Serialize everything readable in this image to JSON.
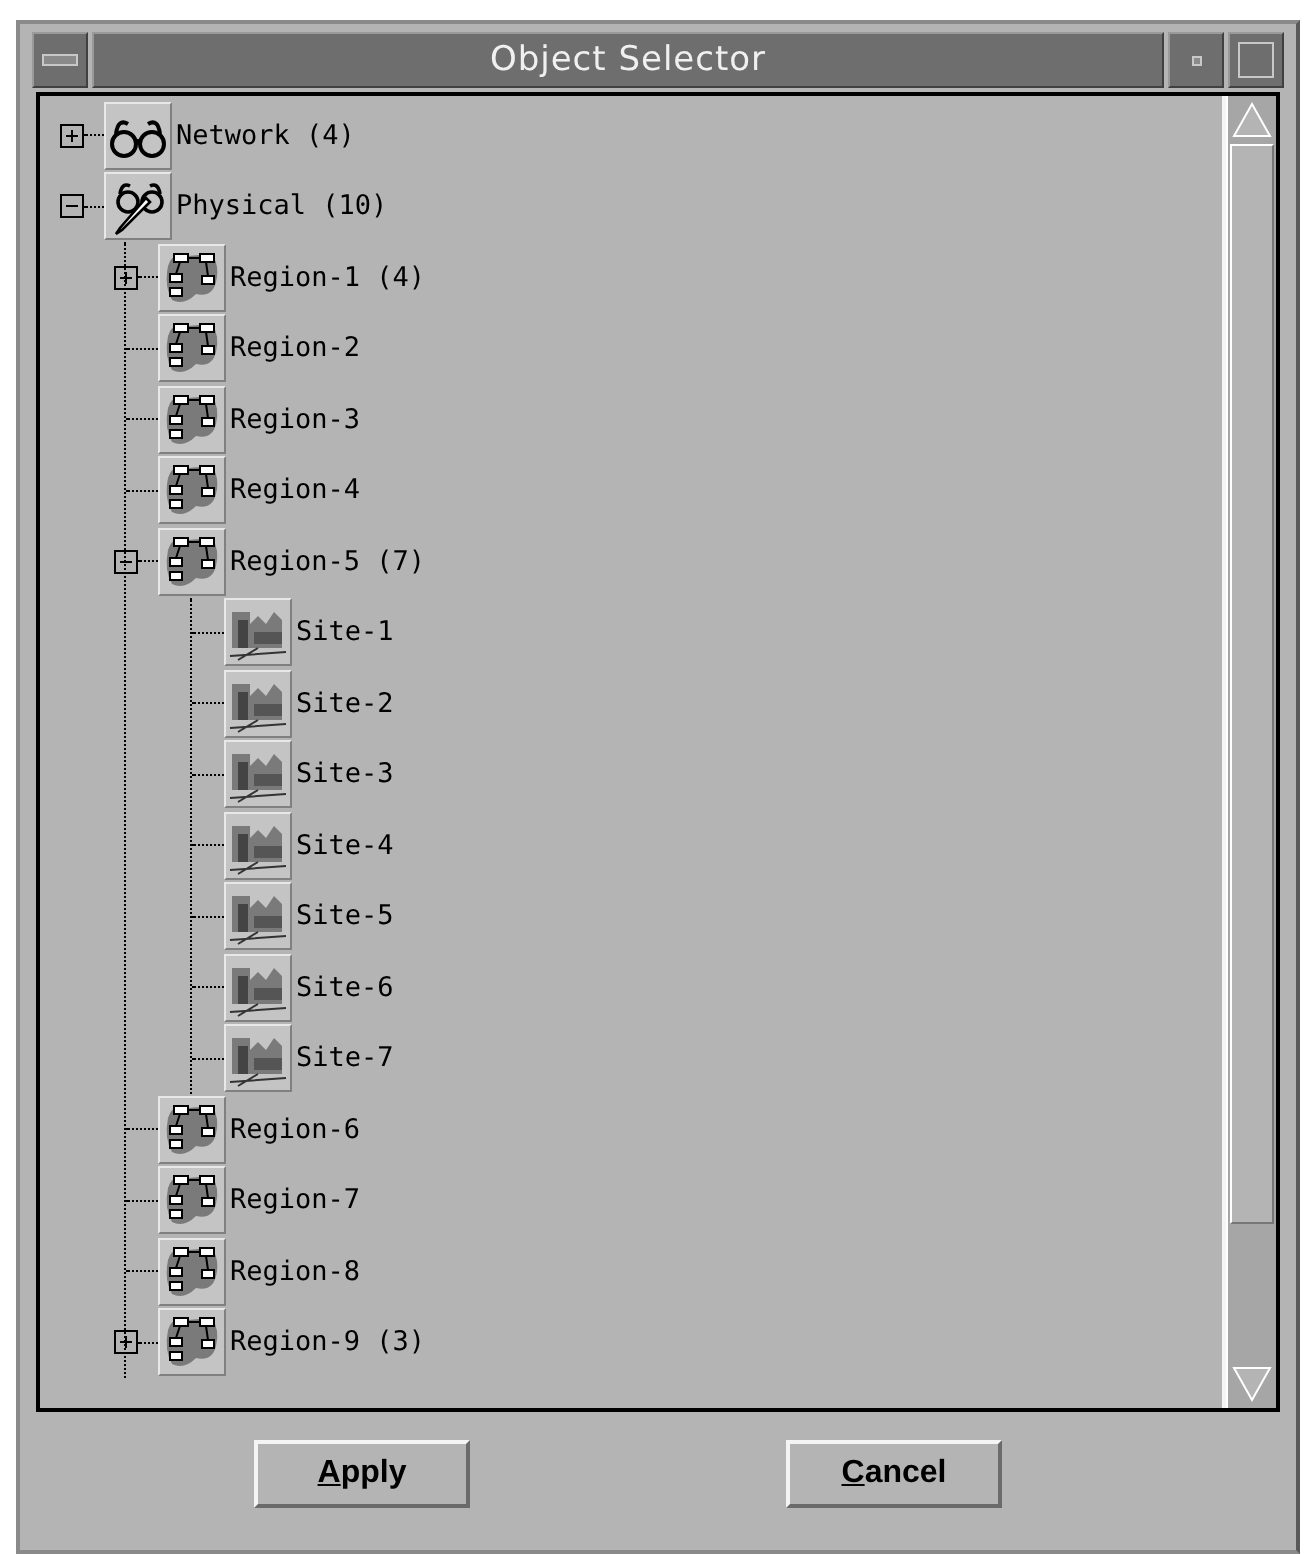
{
  "window": {
    "title": "Object Selector"
  },
  "tree": [
    {
      "label": "Network (4)",
      "kind": "glasses",
      "expanded": false
    },
    {
      "label": "Physical (10)",
      "kind": "glasses-pen",
      "expanded": true,
      "children": [
        {
          "label": "Region-1 (4)",
          "kind": "region",
          "expanded": false
        },
        {
          "label": "Region-2",
          "kind": "region"
        },
        {
          "label": "Region-3",
          "kind": "region"
        },
        {
          "label": "Region-4",
          "kind": "region"
        },
        {
          "label": "Region-5 (7)",
          "kind": "region",
          "expanded": true,
          "children": [
            {
              "label": "Site-1",
              "kind": "site"
            },
            {
              "label": "Site-2",
              "kind": "site"
            },
            {
              "label": "Site-3",
              "kind": "site"
            },
            {
              "label": "Site-4",
              "kind": "site"
            },
            {
              "label": "Site-5",
              "kind": "site"
            },
            {
              "label": "Site-6",
              "kind": "site"
            },
            {
              "label": "Site-7",
              "kind": "site"
            }
          ]
        },
        {
          "label": "Region-6",
          "kind": "region"
        },
        {
          "label": "Region-7",
          "kind": "region"
        },
        {
          "label": "Region-8",
          "kind": "region"
        },
        {
          "label": "Region-9 (3)",
          "kind": "region",
          "expanded": false
        }
      ]
    }
  ],
  "buttons": [
    {
      "label": "Apply"
    },
    {
      "label": "Cancel"
    }
  ]
}
